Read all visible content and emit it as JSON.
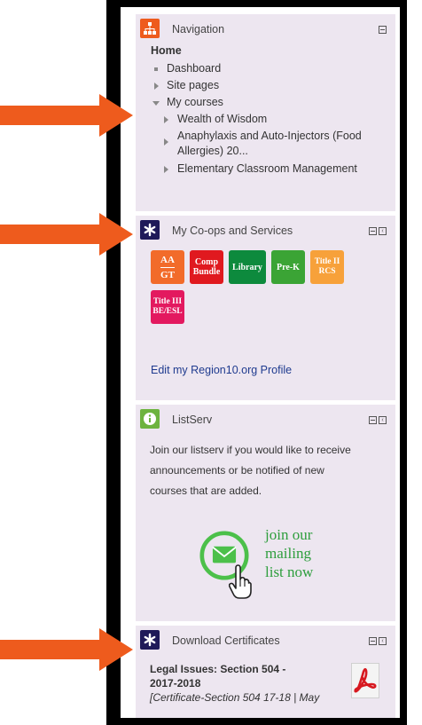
{
  "navigation": {
    "title": "Navigation",
    "home": "Home",
    "items": [
      {
        "label": "Dashboard"
      },
      {
        "label": "Site pages"
      },
      {
        "label": "My courses"
      }
    ],
    "courses": [
      {
        "label": "Wealth of Wisdom"
      },
      {
        "label_line1": "Anaphylaxis and Auto-Injectors (Food",
        "label_line2": "Allergies) 20..."
      },
      {
        "label": "Elementary Classroom Management"
      }
    ]
  },
  "coops": {
    "title": "My Co-ops and Services",
    "tiles": [
      {
        "line1": "AA",
        "line2": "GT",
        "color": "#f26b2a"
      },
      {
        "line1": "Comp",
        "line2": "Bundle",
        "color": "#e0191f"
      },
      {
        "line1": "Library",
        "line2": "",
        "color": "#0d8a3d"
      },
      {
        "line1": "Pre-K",
        "line2": "",
        "color": "#3ba435"
      },
      {
        "line1": "Title II",
        "line2": "RCS",
        "color": "#f7a13a"
      },
      {
        "line1": "Title III",
        "line2": "BE/ESL",
        "color": "#e3195f"
      }
    ],
    "edit_link": "Edit my Region10.org Profile"
  },
  "listserv": {
    "title": "ListServ",
    "description_lines": [
      "Join our listserv if you would like to receive",
      "announcements or be notified of new",
      "courses that are added."
    ],
    "cta_lines": [
      "join our",
      "mailing",
      "list now"
    ]
  },
  "certificates": {
    "title": "Download Certificates",
    "title_line1": "Legal Issues: Section 504 -",
    "title_line2": "2017-2018",
    "meta": "[Certificate-Section 504 17-18 | May"
  },
  "icons": {
    "navigation": "sitemap-icon",
    "coops": "asterisk-icon",
    "listserv": "info-icon",
    "certificates": "asterisk-icon",
    "arrow": "arrow-right-icon",
    "pdf": "pdf-icon",
    "envelope": "envelope-icon",
    "hand": "hand-pointer-icon"
  },
  "colors": {
    "accent_orange": "#ee5b1d",
    "block_bg": "#ede6f0",
    "icon_orange": "#ee5b1d",
    "icon_navy": "#1f1a59",
    "icon_green": "#6db33f",
    "link": "#1f3b8f"
  }
}
